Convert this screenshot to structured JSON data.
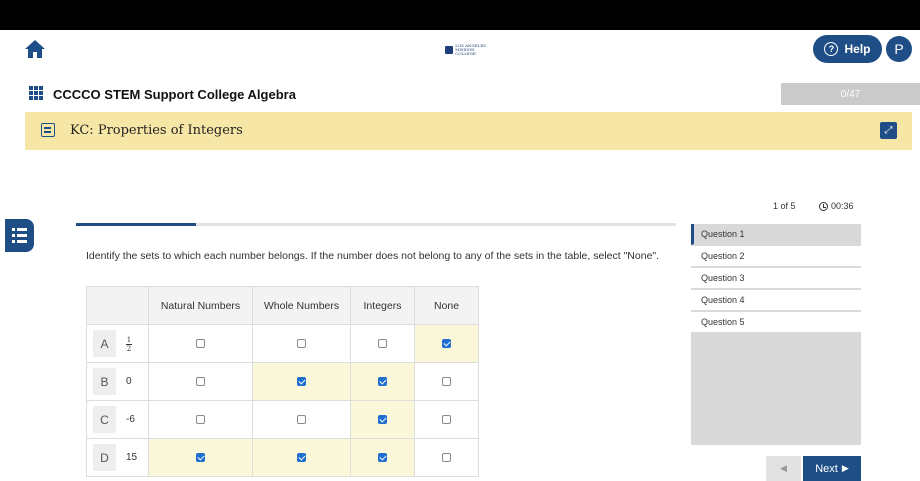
{
  "header": {
    "home_icon": "home-icon",
    "logo_line1": "LOS ANGELES",
    "logo_line2": "MISSION COLLEGE",
    "help_label": "Help",
    "avatar_initial": "P",
    "accent_color": "#1f4e86"
  },
  "course": {
    "title": "CCCCO STEM Support College Algebra",
    "progress_text": "0/47"
  },
  "kc": {
    "title": "KC: Properties of Integers"
  },
  "status": {
    "counter": "1 of 5",
    "timer": "00:36"
  },
  "question": {
    "progress_fraction": 0.2,
    "text": "Identify the sets to which each number belongs. If the number does not belong to any of the sets in the table, select \"None\".",
    "columns": [
      "Natural Numbers",
      "Whole Numbers",
      "Integers",
      "None"
    ],
    "rows": [
      {
        "letter": "A",
        "num_top": "1",
        "num_bottom": "2",
        "is_fraction": true,
        "checked": [
          false,
          false,
          false,
          true
        ]
      },
      {
        "letter": "B",
        "value": "0",
        "checked": [
          false,
          true,
          true,
          false
        ]
      },
      {
        "letter": "C",
        "value": "-6",
        "checked": [
          false,
          false,
          true,
          false
        ]
      },
      {
        "letter": "D",
        "value": "15",
        "checked": [
          true,
          true,
          true,
          false
        ]
      }
    ]
  },
  "question_list": [
    {
      "label": "Question 1",
      "active": true
    },
    {
      "label": "Question 2",
      "active": false
    },
    {
      "label": "Question 3",
      "active": false
    },
    {
      "label": "Question 4",
      "active": false
    },
    {
      "label": "Question 5",
      "active": false
    }
  ],
  "nav": {
    "next_label": "Next"
  }
}
